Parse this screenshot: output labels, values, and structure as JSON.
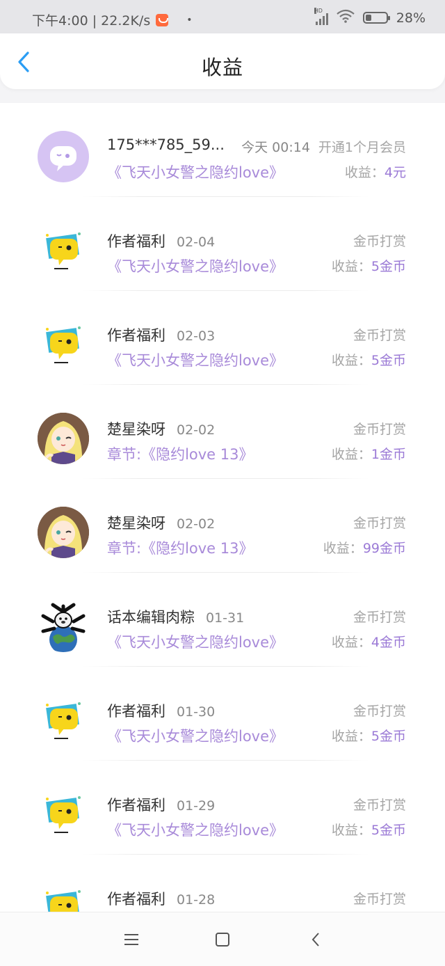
{
  "status_bar": {
    "time_speed": "下午4:00 | 22.2K/s",
    "dot": "•",
    "signal_label": "HD",
    "battery": "28%"
  },
  "header": {
    "title": "收益"
  },
  "income_label": "收益：",
  "rows": [
    {
      "avatar": "purple-chat-avatar",
      "name": "175***785_59...",
      "date": "今天 00:14",
      "type": "开通1个月会员",
      "book": "《飞天小女警之隐约love》",
      "income": "4元"
    },
    {
      "avatar": "yellow-chat-avatar",
      "name": "作者福利",
      "date": "02-04",
      "type": "金币打赏",
      "book": "《飞天小女警之隐约love》",
      "income": "5金币"
    },
    {
      "avatar": "yellow-chat-avatar",
      "name": "作者福利",
      "date": "02-03",
      "type": "金币打赏",
      "book": "《飞天小女警之隐约love》",
      "income": "5金币"
    },
    {
      "avatar": "anime-girl-avatar",
      "name": "楚星染呀",
      "date": "02-02",
      "type": "金币打赏",
      "book": "章节:《隐约love  13》",
      "income": "1金币"
    },
    {
      "avatar": "anime-girl-avatar",
      "name": "楚星染呀",
      "date": "02-02",
      "type": "金币打赏",
      "book": "章节:《隐约love  13》",
      "income": "99金币"
    },
    {
      "avatar": "earth-dog-avatar",
      "name": "话本编辑肉粽",
      "date": "01-31",
      "type": "金币打赏",
      "book": "《飞天小女警之隐约love》",
      "income": "4金币"
    },
    {
      "avatar": "yellow-chat-avatar",
      "name": "作者福利",
      "date": "01-30",
      "type": "金币打赏",
      "book": "《飞天小女警之隐约love》",
      "income": "5金币"
    },
    {
      "avatar": "yellow-chat-avatar",
      "name": "作者福利",
      "date": "01-29",
      "type": "金币打赏",
      "book": "《飞天小女警之隐约love》",
      "income": "5金币"
    },
    {
      "avatar": "yellow-chat-avatar",
      "name": "作者福利",
      "date": "01-28",
      "type": "金币打赏",
      "book": "",
      "income": ""
    }
  ],
  "colors": {
    "accent_purple": "#9b7ad6",
    "book_purple": "#a88ad9",
    "back_blue": "#2a9df4"
  },
  "nav": {
    "menu_icon": "menu-icon",
    "home_icon": "home-icon",
    "back_icon": "back-icon"
  }
}
